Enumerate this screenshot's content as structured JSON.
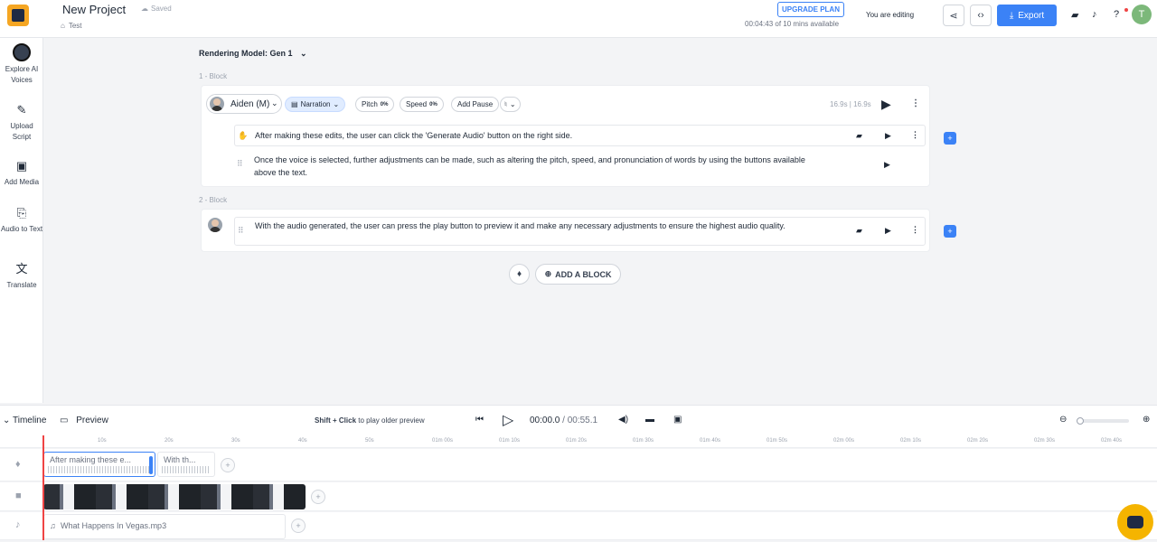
{
  "header": {
    "project_title": "New Project",
    "saved": "Saved",
    "breadcrumb": "Test",
    "upgrade": "UPGRADE PLAN",
    "time_available": "00:04:43 of 10 mins available",
    "editing": "You are editing",
    "export": "Export",
    "avatar_initial": "T"
  },
  "sidebar": {
    "items": [
      {
        "label": "Explore AI Voices",
        "icon": "ai-voice-avatar"
      },
      {
        "label": "Upload Script",
        "icon": "upload-script-icon"
      },
      {
        "label": "Add Media",
        "icon": "media-icon"
      },
      {
        "label": "Audio to Text",
        "icon": "transcribe-icon"
      },
      {
        "label": "Translate",
        "icon": "translate-icon"
      }
    ]
  },
  "editor": {
    "rendering_model": "Rendering Model: Gen 1",
    "blocks": [
      {
        "label": "1 -  Block",
        "voice": "Aiden (M)",
        "style": "Narration",
        "pitch_label": "Pitch",
        "pitch_value": "0%",
        "speed_label": "Speed",
        "speed_value": "0%",
        "add_pause": "Add Pause",
        "duration": "16.9s | 16.9s",
        "paragraphs": [
          "After making these edits, the user can click the 'Generate Audio' button on the right side.",
          "Once the voice is selected, further adjustments can be made, such as altering the pitch, speed, and pronunciation of words by using the buttons available above the text."
        ]
      },
      {
        "label": "2 -  Block",
        "paragraphs": [
          "With the audio generated, the user can press the play button to preview it and make any necessary adjustments to ensure the highest audio quality."
        ]
      }
    ],
    "add_block": "ADD A BLOCK"
  },
  "timeline": {
    "tab_timeline": "Timeline",
    "tab_preview": "Preview",
    "hint_bold": "Shift + Click",
    "hint_rest": " to play older preview",
    "current_time": "00:00.0",
    "total_time": "/ 00:55.1",
    "ruler": [
      "10s",
      "20s",
      "30s",
      "40s",
      "50s",
      "01m 00s",
      "01m 10s",
      "01m 20s",
      "01m 30s",
      "01m 40s",
      "01m 50s",
      "02m 00s",
      "02m 10s",
      "02m 20s",
      "02m 30s",
      "02m 40s",
      "02m 50s"
    ],
    "voice_clips": [
      "After making these e...",
      "With th..."
    ],
    "music_clip": "What Happens In Vegas.mp3"
  },
  "colors": {
    "accent": "#3b82f6",
    "brand": "#f5a623",
    "playhead": "#ef4444"
  }
}
